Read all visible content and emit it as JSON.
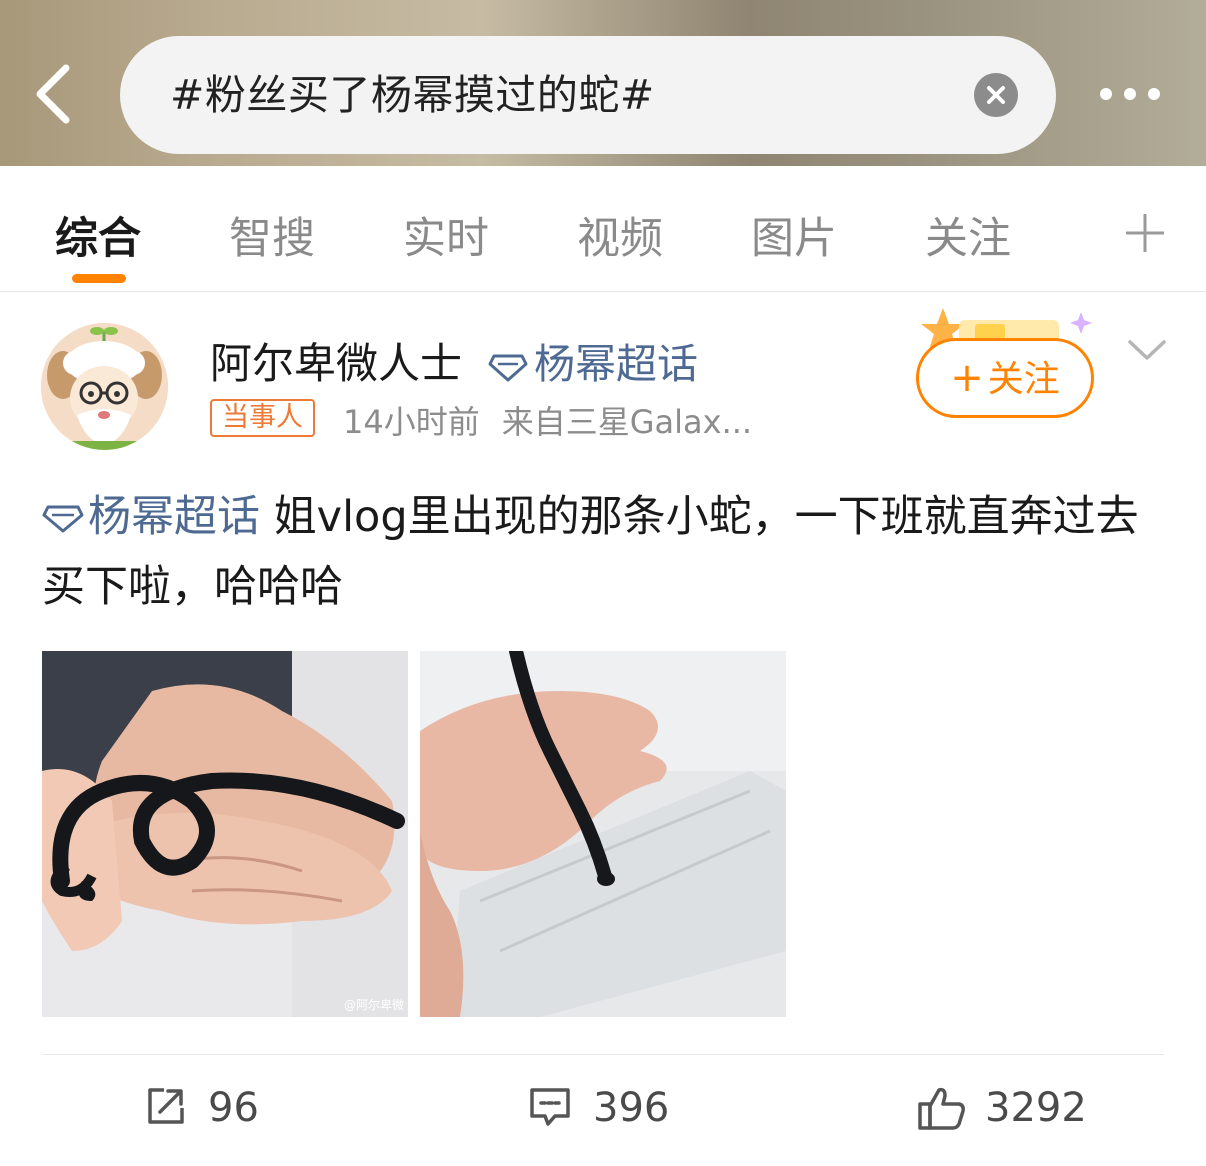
{
  "header": {
    "back_icon": "chevron-left-icon",
    "search_query": "#粉丝买了杨幂摸过的蛇#",
    "clear_icon": "close-circle-icon",
    "more_icon": "more-dots-icon"
  },
  "tabs": [
    {
      "label": "综合",
      "active": true
    },
    {
      "label": "智搜",
      "active": false
    },
    {
      "label": "实时",
      "active": false
    },
    {
      "label": "视频",
      "active": false
    },
    {
      "label": "图片",
      "active": false
    },
    {
      "label": "关注",
      "active": false
    }
  ],
  "tab_add_icon": "plus-icon",
  "post": {
    "author": "阿尔卑微人士",
    "topic": "杨幂超话",
    "badge": "当事人",
    "time": "14小时前",
    "source": "来自三星Galax...",
    "follow_label": "关注",
    "text_topic": "杨幂超话",
    "text_body": " 姐vlog里出现的那条小蛇，一下班就直奔过去买下啦，哈哈哈",
    "watermark": "@阿尔卑微",
    "actions": {
      "repost_count": "96",
      "comment_count": "396",
      "like_count": "3292"
    }
  },
  "colors": {
    "accent": "#ff8200",
    "link": "#4e6a93",
    "badge": "#ee7a38"
  }
}
